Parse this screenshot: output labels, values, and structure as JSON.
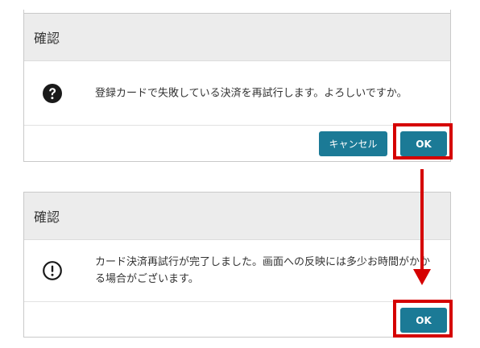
{
  "dialog_confirm": {
    "title": "確認",
    "icon": "question-circle-icon",
    "message": "登録カードで失敗している決済を再試行します。よろしいですか。",
    "cancel_label": "キャンセル",
    "ok_label": "OK"
  },
  "dialog_complete": {
    "title": "確認",
    "icon": "exclamation-circle-icon",
    "message": "カード決済再試行が完了しました。画面への反映には多少お時間がかかる場合がございます。",
    "ok_label": "OK"
  },
  "colors": {
    "button": "#1b7a96",
    "highlight": "#d50000",
    "header_bg": "#ececec"
  }
}
